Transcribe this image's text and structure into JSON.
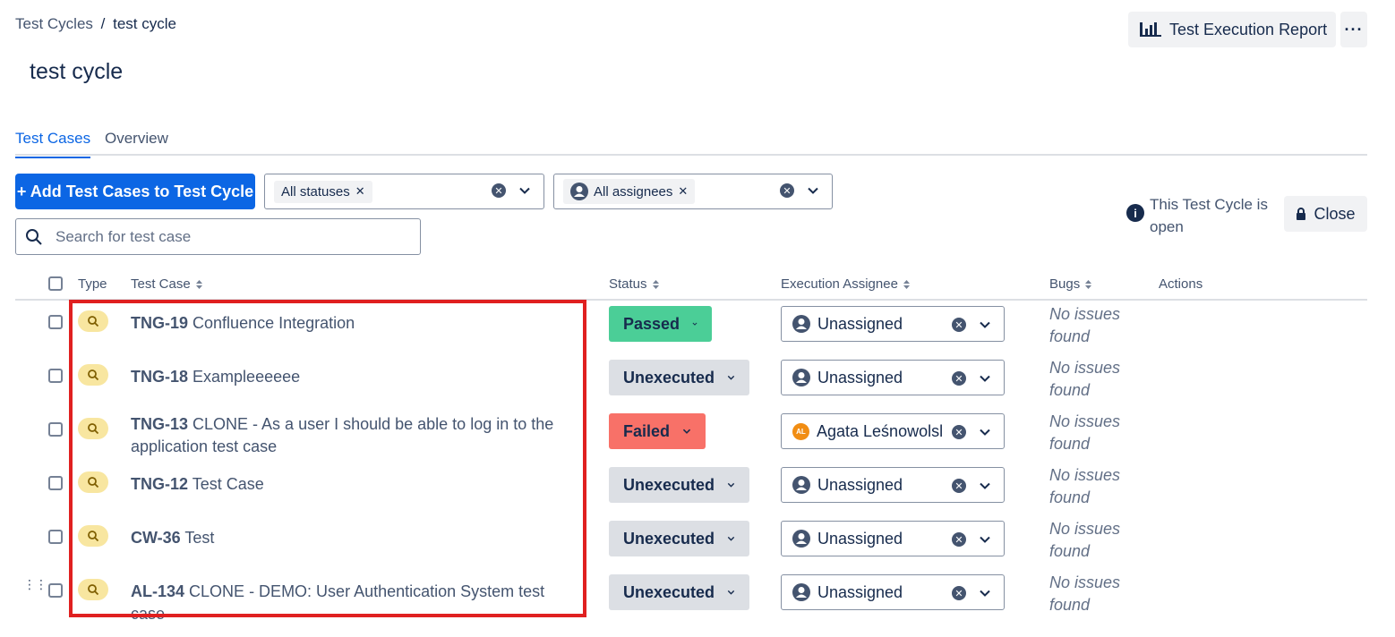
{
  "breadcrumb": {
    "parent": "Test Cycles",
    "separator": "/",
    "current": "test cycle"
  },
  "header": {
    "report_label": "Test Execution Report",
    "more_label": "···"
  },
  "page": {
    "title": "test cycle"
  },
  "tabs": [
    {
      "label": "Test Cases",
      "active": true
    },
    {
      "label": "Overview",
      "active": false
    }
  ],
  "toolbar": {
    "add_label": "+ Add Test Cases to Test Cycle",
    "status_filter": "All statuses",
    "assignee_filter": "All assignees",
    "search_placeholder": "Search for test case"
  },
  "cycle": {
    "info_text": "This Test Cycle is open",
    "close_label": "Close"
  },
  "columns": {
    "type": "Type",
    "test_case": "Test Case",
    "status": "Status",
    "assignee": "Execution Assignee",
    "bugs": "Bugs",
    "actions": "Actions"
  },
  "rows": [
    {
      "key": "TNG-19",
      "title": "Confluence Integration",
      "status": "Passed",
      "assignee": "Unassigned",
      "bugs": "No issues found"
    },
    {
      "key": "TNG-18",
      "title": "Exampleeeeee",
      "status": "Unexecuted",
      "assignee": "Unassigned",
      "bugs": "No issues found"
    },
    {
      "key": "TNG-13",
      "title": "CLONE - As a user I should be able to log in to the application test case",
      "status": "Failed",
      "assignee": "Agata Leśnowolsl",
      "assignee_initials": "AL",
      "bugs": "No issues found"
    },
    {
      "key": "TNG-12",
      "title": "Test Case",
      "status": "Unexecuted",
      "assignee": "Unassigned",
      "bugs": "No issues found"
    },
    {
      "key": "CW-36",
      "title": "Test",
      "status": "Unexecuted",
      "assignee": "Unassigned",
      "bugs": "No issues found"
    },
    {
      "key": "AL-134",
      "title": "CLONE - DEMO: User Authentication System test case",
      "status": "Unexecuted",
      "assignee": "Unassigned",
      "bugs": "No issues found"
    }
  ],
  "colors": {
    "primary": "#0c66e4",
    "passed": "#4bce97",
    "failed": "#f87168",
    "unexecuted": "#dcdfe4",
    "highlight": "#e02020",
    "test_case_icon_bg": "#f8e6a0"
  },
  "icons": {
    "report": "bar-chart-icon",
    "info": "info-icon",
    "lock": "lock-icon",
    "search": "search-icon",
    "type": "test-case-search-icon"
  }
}
